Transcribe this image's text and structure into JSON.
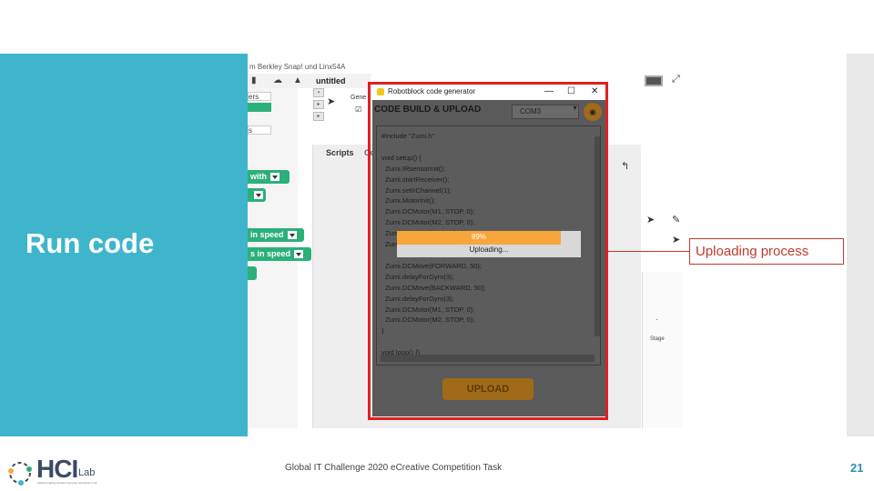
{
  "slide": {
    "title": "Run code",
    "callout": "Uploading process",
    "footer": "Global IT Challenge 2020 eCreative Competition Task",
    "page_number": "21",
    "logo_text": "HCI",
    "logo_suffix": "Lab",
    "logo_tagline": "Global Leading Human-Computer Interaction Lab"
  },
  "snap": {
    "window_title": "m Berkley Snap! und Linx54A",
    "project_name": "untitled",
    "categories": [
      "ers",
      "",
      "s"
    ],
    "blocks": [
      {
        "label": "with"
      },
      {
        "label": ""
      },
      {
        "label": "in speed"
      },
      {
        "label": "s in speed"
      }
    ],
    "tabs": {
      "scripts": "Scripts",
      "costumes": "Co"
    },
    "stage_label": "Stage",
    "generator_short": "Gene",
    "stage_dot": "·"
  },
  "dialog": {
    "title": "Robotblock code generator",
    "minimize": "—",
    "maximize": "☐",
    "close": "✕",
    "header": "CODE BUILD & UPLOAD",
    "port": "COM3",
    "code_lines": [
      "#include \"Zumi.h\"",
      "",
      "void setup() {",
      "  Zumi.IRsensorInit();",
      "  Zumi.startReceiver();",
      "  Zumi.setIrChannel(1);",
      "  Zumi.MotorInit();",
      "  Zumi.DCMotor(M1, STOP, 0);",
      "  Zumi.DCMotor(M2, STOP, 0);",
      "  Zumi.MoveCalibration();",
      "  Zumi.",
      "",
      "  Zumi.DCMove(FORWARD, 50);",
      "  Zumi.delayForGyro(3);",
      "  Zumi.DCMove(BACKWARD, 50);",
      "  Zumi.delayForGyro(3);",
      "  Zumi.DCMotor(M1, STOP, 0);",
      "  Zumi.DCMotor(M2, STOP, 0);",
      "}",
      "",
      "void loop() {}"
    ],
    "progress": {
      "percent_label": "89%",
      "fraction": 0.89,
      "status": "Uploading..."
    },
    "upload_button": "UPLOAD"
  },
  "colors": {
    "teal": "#3fb5cc",
    "highlight": "#e02020",
    "progress": "#f7a63c",
    "upload": "#a06a1a",
    "callout": "#c0392b",
    "page_number": "#2f8fb0"
  }
}
